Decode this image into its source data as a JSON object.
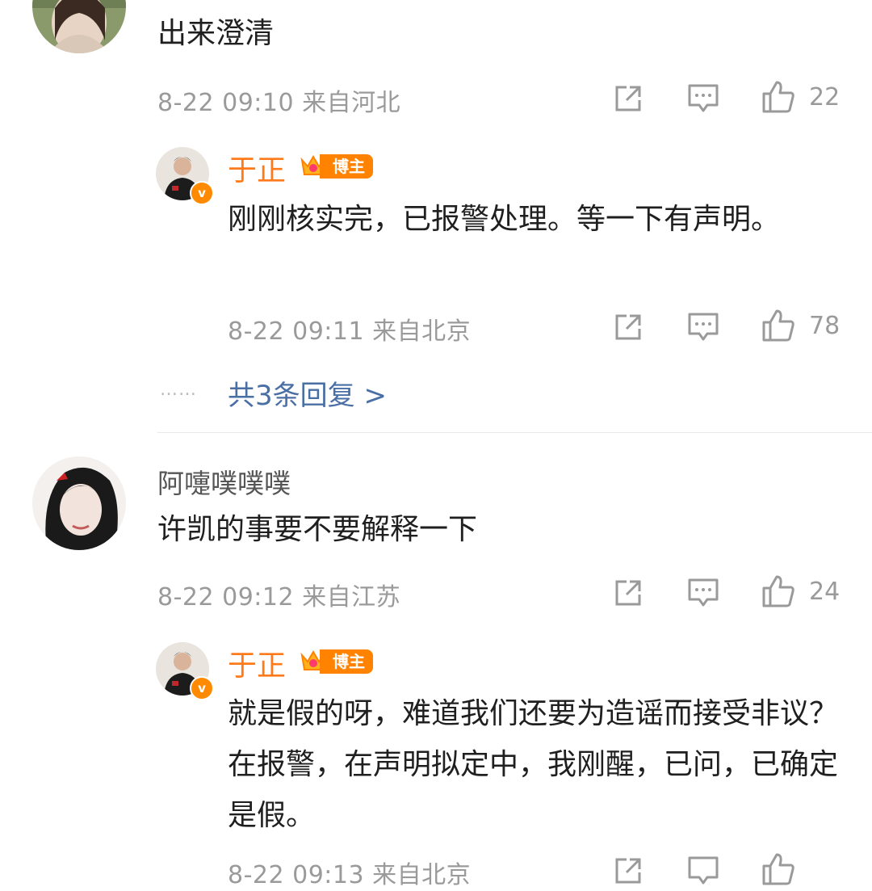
{
  "comments": [
    {
      "text": "出来澄清",
      "meta": "8-22 09:10 来自河北",
      "likes": "22",
      "reply": {
        "author": "于正",
        "badge": "博主",
        "text": "刚刚核实完，已报警处理。等一下有声明。",
        "meta": "8-22 09:11 来自北京",
        "likes": "78"
      },
      "more_replies": "共3条回复 >",
      "dots": "……"
    },
    {
      "username": "阿嚏噗噗噗",
      "text": "许凯的事要不要解释一下",
      "meta": "8-22 09:12 来自江苏",
      "likes": "24",
      "reply": {
        "author": "于正",
        "badge": "博主",
        "text": "就是假的呀，难道我们还要为造谣而接受非议？在报警，在声明拟定中，我刚醒，已问，已确定是假。",
        "meta": "8-22 09:13 来自北京"
      }
    }
  ],
  "colors": {
    "author": "#ff7a1a",
    "link": "#4a6fa5",
    "meta": "#9a9a9a"
  },
  "icons": [
    "share-icon",
    "comment-icon",
    "like-icon",
    "verified-v-icon",
    "crown-badge-icon"
  ]
}
